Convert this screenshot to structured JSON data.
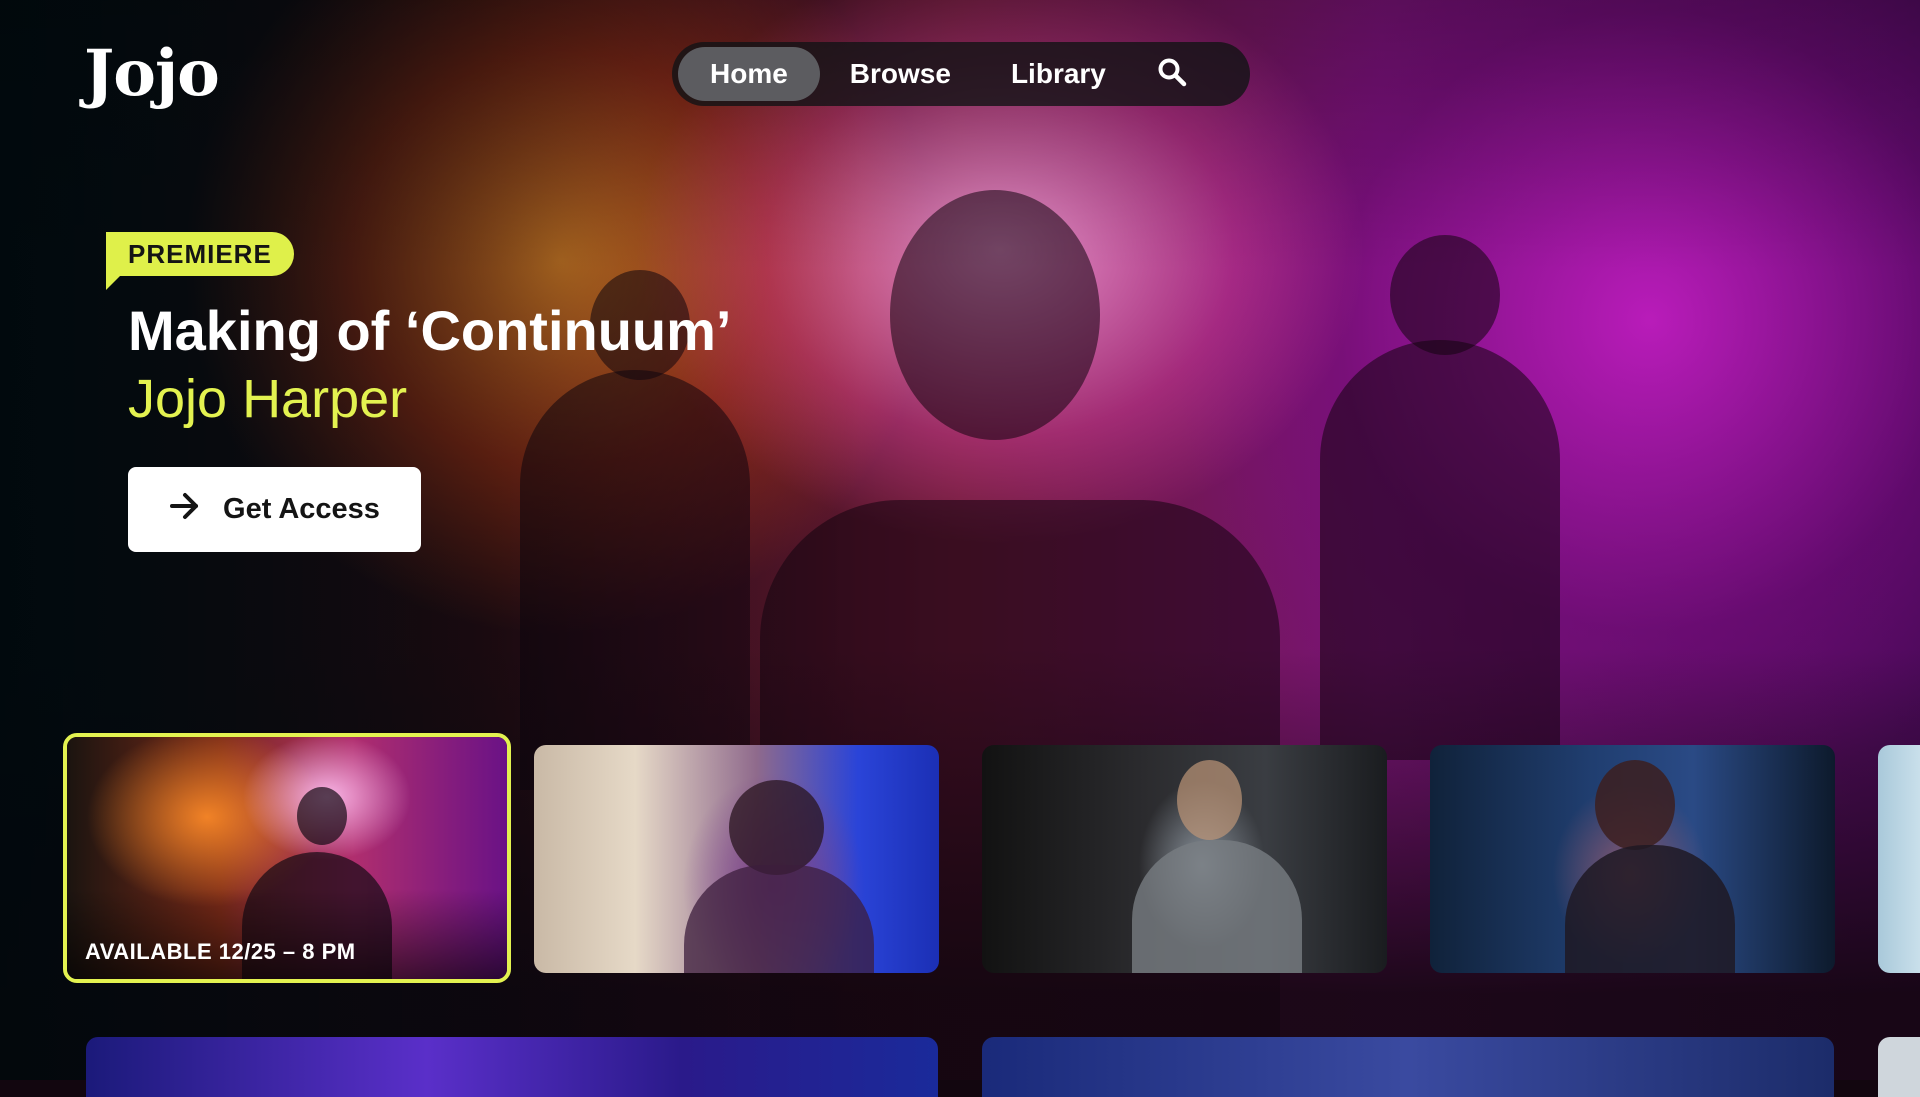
{
  "app": {
    "logo": "Jojo"
  },
  "nav": {
    "items": [
      {
        "label": "Home",
        "active": true
      },
      {
        "label": "Browse",
        "active": false
      },
      {
        "label": "Library",
        "active": false
      }
    ],
    "search_icon": "search-icon"
  },
  "hero": {
    "badge": "PREMIERE",
    "title": "Making of ‘Continuum’",
    "subtitle": "Jojo Harper",
    "cta_label": "Get Access",
    "cta_icon": "arrow-right-icon"
  },
  "carousel": {
    "cards": [
      {
        "label": "AVAILABLE 12/25 – 8 PM",
        "focused": true
      },
      {
        "label": "",
        "focused": false
      },
      {
        "label": "",
        "focused": false
      },
      {
        "label": "",
        "focused": false
      },
      {
        "label": "",
        "focused": false
      }
    ]
  },
  "colors": {
    "accent": "#e3f250",
    "badge_bg": "#dff04a",
    "nav_bg": "#141416",
    "nav_active": "#5c5c60",
    "cta_bg": "#ffffff"
  }
}
